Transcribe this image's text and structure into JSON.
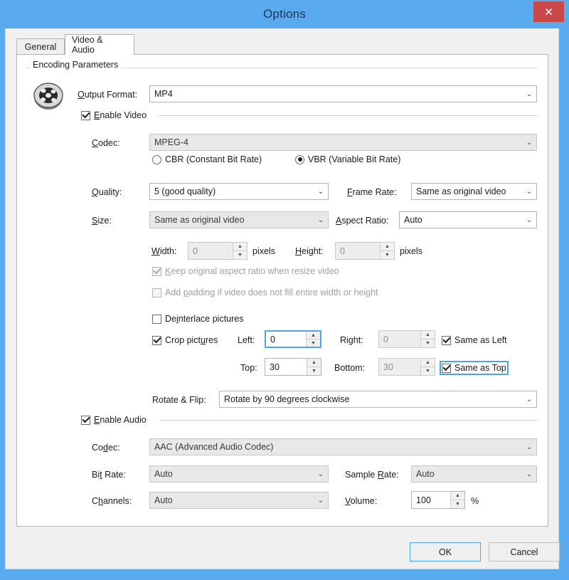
{
  "window": {
    "title": "Options",
    "close_label": "✕",
    "accent_titlebar": "#5aaaf0",
    "close_color": "#c9494b"
  },
  "tabs": [
    {
      "label": "General",
      "active": false
    },
    {
      "label": "Video & Audio",
      "active": true
    }
  ],
  "group": {
    "title": "Encoding Parameters",
    "icon": "film-reel-icon"
  },
  "video": {
    "output_format_label": "Output Format:",
    "output_format_value": "MP4",
    "enable_video_label": "Enable Video",
    "enable_video_checked": true,
    "codec_label": "Codec:",
    "codec_value": "MPEG-4",
    "bitrate_mode": [
      {
        "label": "CBR (Constant Bit Rate)",
        "selected": false
      },
      {
        "label": "VBR (Variable Bit Rate)",
        "selected": true
      }
    ],
    "quality_label": "Quality:",
    "quality_value": "5 (good quality)",
    "frame_rate_label": "Frame Rate:",
    "frame_rate_value": "Same as original video",
    "size_label": "Size:",
    "size_value": "Same as original video",
    "aspect_ratio_label": "Aspect Ratio:",
    "aspect_ratio_value": "Auto",
    "width_label": "Width:",
    "width_value": "0",
    "width_unit": "pixels",
    "height_label": "Height:",
    "height_value": "0",
    "height_unit": "pixels",
    "keep_aspect_label": "Keep original aspect ratio when resize video",
    "keep_aspect_checked": true,
    "add_padding_label": "Add padding if video does not fill entire width or height",
    "add_padding_checked": false,
    "deinterlace_label": "Deinterlace pictures",
    "deinterlace_checked": false,
    "crop_label": "Crop pictures",
    "crop_checked": true,
    "crop_left_label": "Left:",
    "crop_left_value": "0",
    "crop_right_label": "Right:",
    "crop_right_value": "0",
    "same_as_left_label": "Same as Left",
    "same_as_left_checked": true,
    "crop_top_label": "Top:",
    "crop_top_value": "30",
    "crop_bottom_label": "Bottom:",
    "crop_bottom_value": "30",
    "same_as_top_label": "Same as Top",
    "same_as_top_checked": true,
    "rotate_label": "Rotate & Flip:",
    "rotate_value": "Rotate by 90 degrees clockwise"
  },
  "audio": {
    "enable_audio_label": "Enable Audio",
    "enable_audio_checked": true,
    "codec_label": "Codec:",
    "codec_value": "AAC (Advanced Audio Codec)",
    "bit_rate_label": "Bit Rate:",
    "bit_rate_value": "Auto",
    "sample_rate_label": "Sample Rate:",
    "sample_rate_value": "Auto",
    "channels_label": "Channels:",
    "channels_value": "Auto",
    "volume_label": "Volume:",
    "volume_value": "100",
    "volume_unit": "%"
  },
  "footer": {
    "ok_label": "OK",
    "cancel_label": "Cancel"
  },
  "icons": {
    "chevron_down": "⌄",
    "spin_up": "▲",
    "spin_down": "▼"
  }
}
